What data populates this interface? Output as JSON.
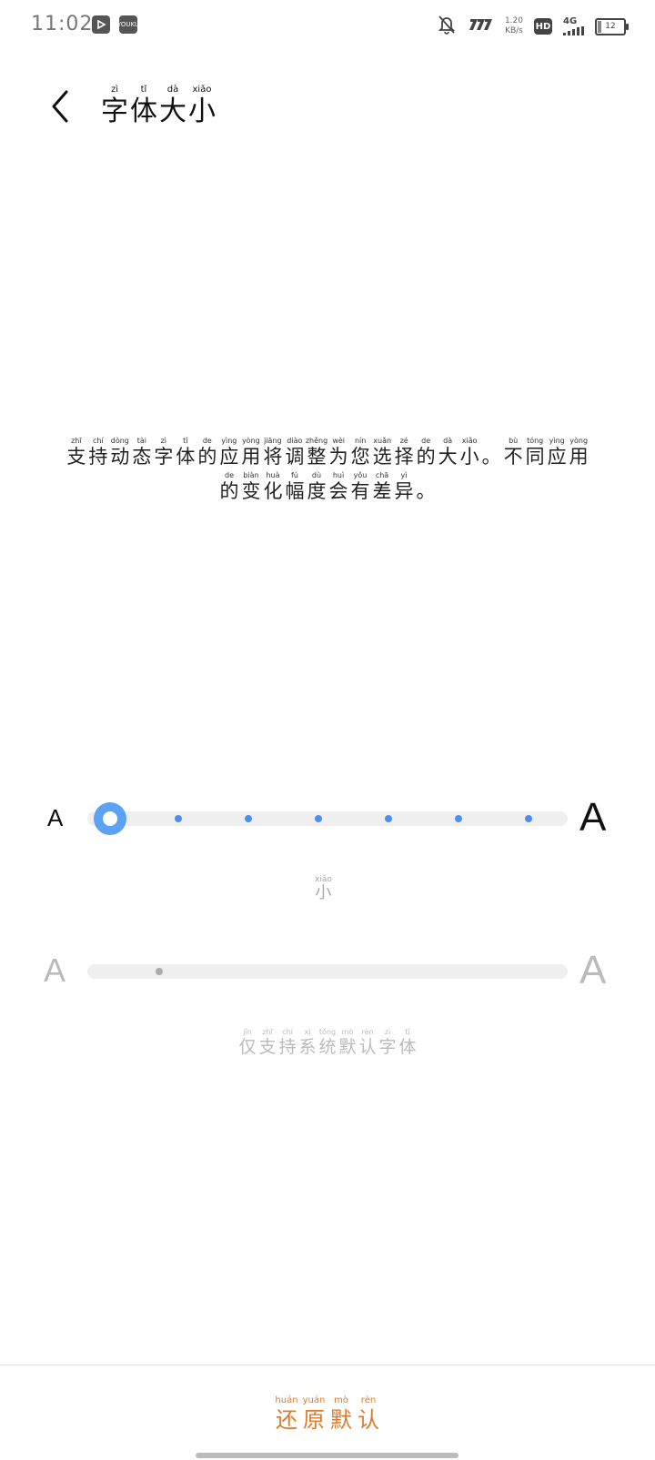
{
  "status_bar": {
    "time": "11:02",
    "app_icons": [
      "play-icon",
      "youku-icon"
    ],
    "youku_label": "YOUKU",
    "net_speed_value": "1.20",
    "net_speed_unit": "KB/s",
    "hd_label": "HD",
    "network_label": "4G",
    "battery_level": "12"
  },
  "header": {
    "title": [
      {
        "py": "zì",
        "hz": "字"
      },
      {
        "py": "tǐ",
        "hz": "体"
      },
      {
        "py": "dà",
        "hz": "大"
      },
      {
        "py": "xiǎo",
        "hz": "小"
      }
    ]
  },
  "description": {
    "line1": [
      {
        "py": "zhī",
        "hz": "支"
      },
      {
        "py": "chí",
        "hz": "持"
      },
      {
        "py": "dòng",
        "hz": "动"
      },
      {
        "py": "tài",
        "hz": "态"
      },
      {
        "py": "zì",
        "hz": "字"
      },
      {
        "py": "tǐ",
        "hz": "体"
      },
      {
        "py": "de",
        "hz": "的"
      },
      {
        "py": "yìng",
        "hz": "应"
      },
      {
        "py": "yòng",
        "hz": "用"
      },
      {
        "py": "jiāng",
        "hz": "将"
      },
      {
        "py": "diào",
        "hz": "调"
      },
      {
        "py": "zhěng",
        "hz": "整"
      },
      {
        "py": "wèi",
        "hz": "为"
      },
      {
        "py": "nín",
        "hz": "您"
      },
      {
        "py": "xuǎn",
        "hz": "选"
      },
      {
        "py": "zé",
        "hz": "择"
      },
      {
        "py": "de",
        "hz": "的"
      },
      {
        "py": "dà",
        "hz": "大"
      },
      {
        "py": "xiǎo",
        "hz": "小"
      },
      {
        "py": "",
        "hz": "。"
      },
      {
        "py": "bù",
        "hz": "不"
      },
      {
        "py": "tóng",
        "hz": "同"
      },
      {
        "py": "yìng",
        "hz": "应"
      },
      {
        "py": "yòng",
        "hz": "用"
      }
    ],
    "line2": [
      {
        "py": "de",
        "hz": "的"
      },
      {
        "py": "biàn",
        "hz": "变"
      },
      {
        "py": "huà",
        "hz": "化"
      },
      {
        "py": "fú",
        "hz": "幅"
      },
      {
        "py": "dù",
        "hz": "度"
      },
      {
        "py": "huì",
        "hz": "会"
      },
      {
        "py": "yǒu",
        "hz": "有"
      },
      {
        "py": "chā",
        "hz": "差"
      },
      {
        "py": "yì",
        "hz": "异"
      },
      {
        "py": "",
        "hz": "。"
      }
    ]
  },
  "font_size_slider": {
    "small_label": "A",
    "large_label": "A",
    "steps": 7,
    "selected_index": 0,
    "accent_color": "#5ba1f4",
    "current_size_label": {
      "py": "xiǎo",
      "hz": "小"
    }
  },
  "font_weight_slider": {
    "small_label": "A",
    "large_label": "A",
    "enabled": false
  },
  "note": [
    {
      "py": "jǐn",
      "hz": "仅"
    },
    {
      "py": "zhī",
      "hz": "支"
    },
    {
      "py": "chí",
      "hz": "持"
    },
    {
      "py": "xì",
      "hz": "系"
    },
    {
      "py": "tǒng",
      "hz": "统"
    },
    {
      "py": "mò",
      "hz": "默"
    },
    {
      "py": "rèn",
      "hz": "认"
    },
    {
      "py": "zì",
      "hz": "字"
    },
    {
      "py": "tǐ",
      "hz": "体"
    }
  ],
  "restore_button": [
    {
      "py": "huán",
      "hz": "还"
    },
    {
      "py": "yuán",
      "hz": "原"
    },
    {
      "py": "mò",
      "hz": "默"
    },
    {
      "py": "rèn",
      "hz": "认"
    }
  ],
  "colors": {
    "accent": "#5ba1f4",
    "restore": "#e07a2a",
    "disabled": "#bbbbbb"
  }
}
